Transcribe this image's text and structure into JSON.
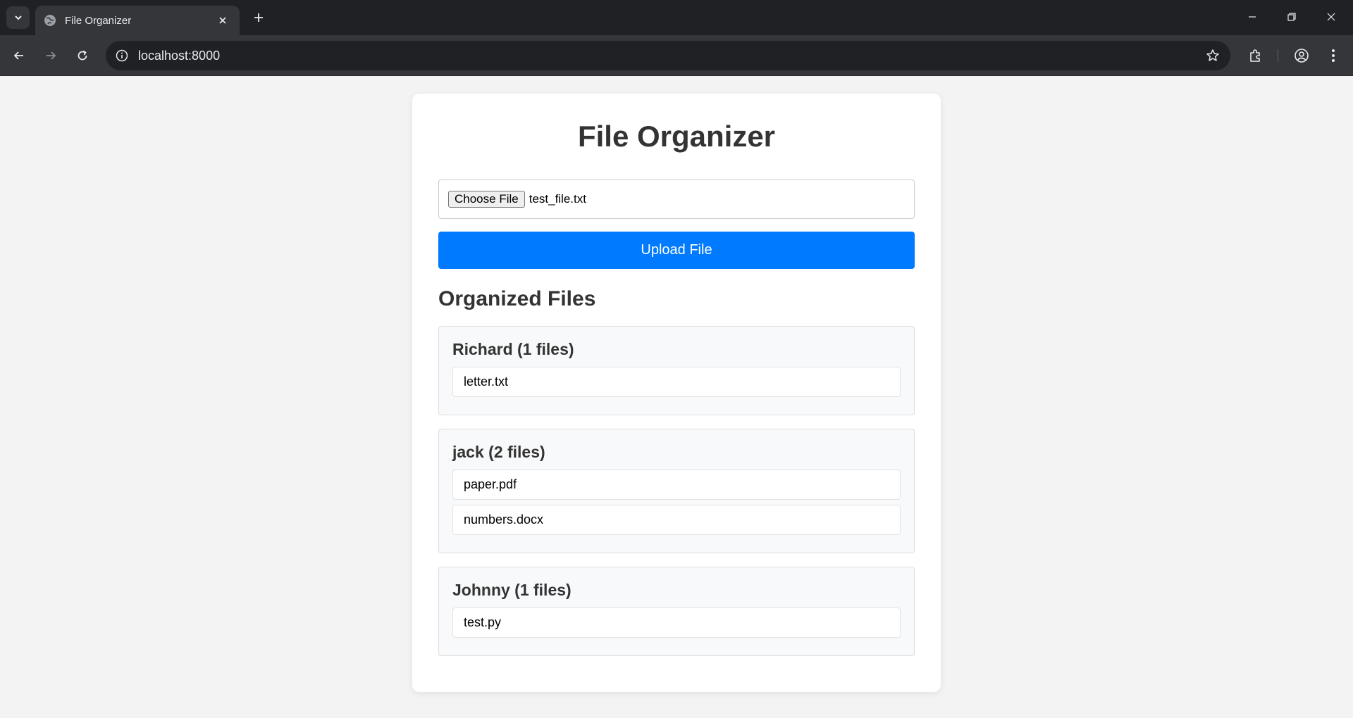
{
  "browser": {
    "tab_title": "File Organizer",
    "url": "localhost:8000"
  },
  "app": {
    "title": "File Organizer",
    "file_input": {
      "button_label": "Choose File",
      "selected_file": "test_file.txt"
    },
    "upload_label": "Upload File",
    "section_title": "Organized Files",
    "groups": [
      {
        "title": "Richard (1 files)",
        "files": [
          "letter.txt"
        ]
      },
      {
        "title": "jack (2 files)",
        "files": [
          "paper.pdf",
          "numbers.docx"
        ]
      },
      {
        "title": "Johnny (1 files)",
        "files": [
          "test.py"
        ]
      }
    ]
  },
  "colors": {
    "accent": "#007bff",
    "background": "#f3f3f3",
    "card": "#ffffff",
    "group_bg": "#f8f9fa"
  }
}
